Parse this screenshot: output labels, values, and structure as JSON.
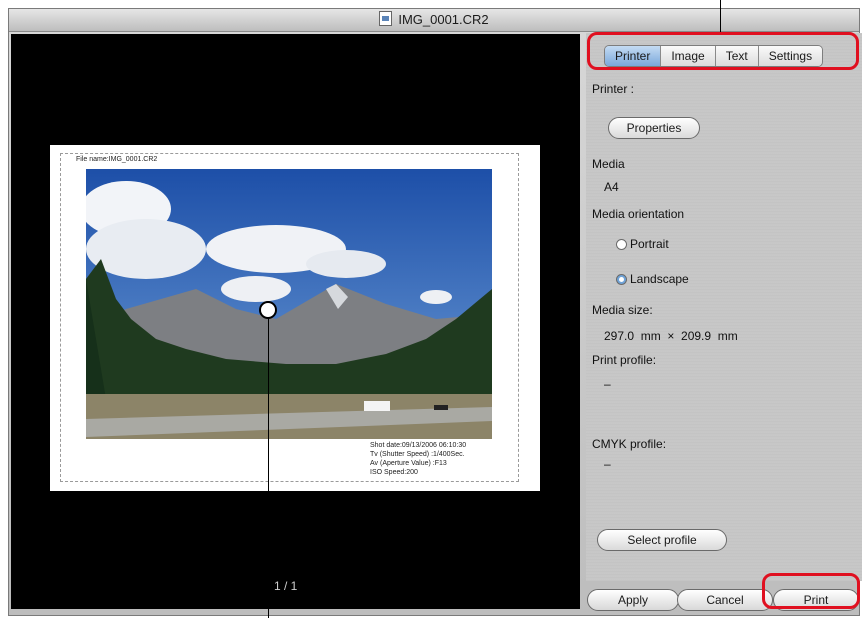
{
  "window": {
    "title": "IMG_0001.CR2"
  },
  "preview": {
    "file_name_label": "File name:IMG_0001.CR2",
    "shot_info": [
      "Shot date:09/13/2006 06:10:30",
      "Tv (Shutter Speed) :1/400Sec.",
      "Av (Aperture Value) :F13",
      "ISO Speed:200"
    ],
    "page_indicator": "1 / 1"
  },
  "tabs": [
    "Printer",
    "Image",
    "Text",
    "Settings"
  ],
  "active_tab": "Printer",
  "printer_panel": {
    "printer_label": "Printer :",
    "properties_button": "Properties",
    "media_label": "Media",
    "media_value": "A4",
    "orientation_label": "Media orientation",
    "orientation_options": [
      "Portrait",
      "Landscape"
    ],
    "orientation_selected": "Landscape",
    "media_size_label": "Media size:",
    "media_size_value": "297.0  mm  ×  209.9  mm",
    "print_profile_label": "Print profile:",
    "print_profile_value": "–",
    "cmyk_profile_label": "CMYK profile:",
    "cmyk_profile_value": "–",
    "select_profile_button": "Select profile"
  },
  "footer": {
    "apply": "Apply",
    "cancel": "Cancel",
    "print": "Print"
  },
  "colors": {
    "highlight": "#e01020",
    "active_tab": "#7aa8db"
  }
}
